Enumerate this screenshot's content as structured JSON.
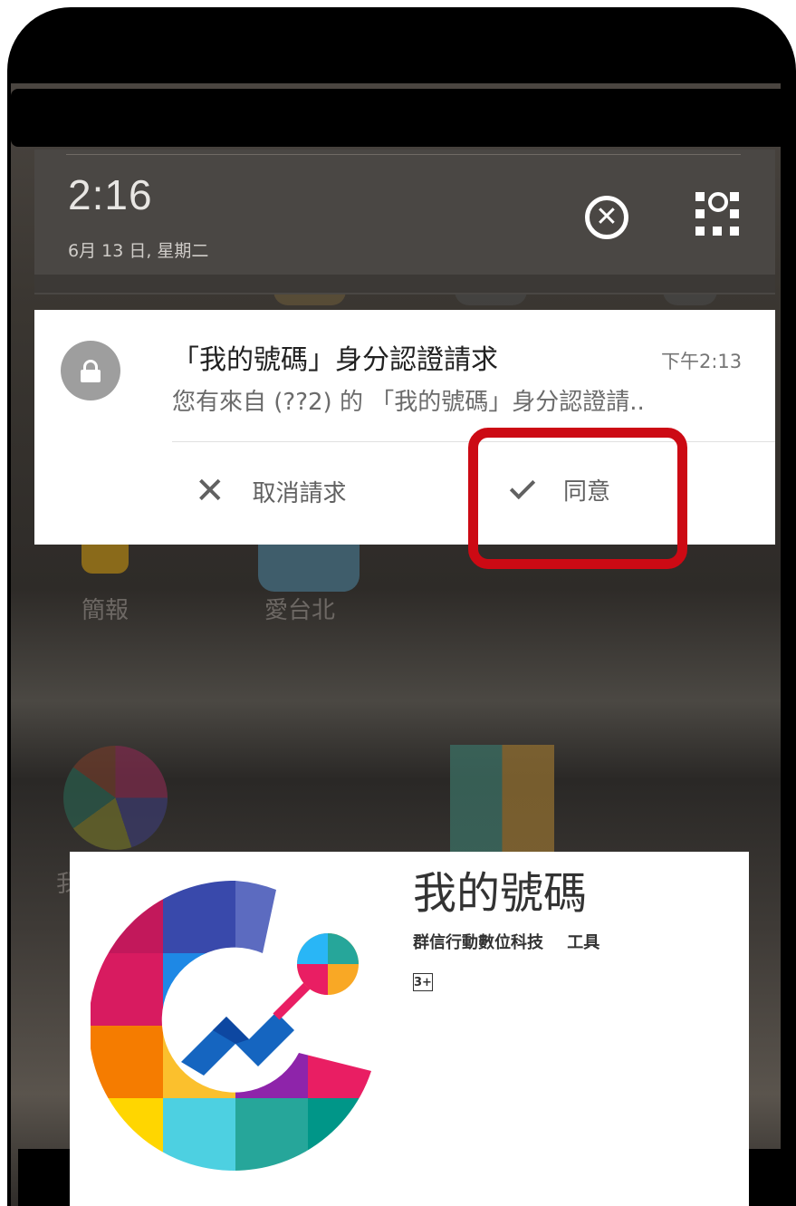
{
  "quick_panel": {
    "time": "2:16",
    "date": "6月 13 日, 星期二"
  },
  "notification": {
    "title": "「我的號碼」身分認證請求",
    "time": "下午2:13",
    "text": "您有來自 (??2) 的 「我的號碼」身分認證請..",
    "actions": {
      "cancel_label": "取消請求",
      "accept_label": "同意"
    }
  },
  "home": {
    "apps": [
      {
        "label": "簡報"
      },
      {
        "label": "愛台北"
      }
    ],
    "partial_label": "我"
  },
  "store": {
    "app_name": "我的號碼",
    "developer": "群信行動數位科技",
    "category": "工具",
    "rating": "3+"
  },
  "colors": {
    "highlight": "#cc0a14",
    "notification_bg": "#ffffff",
    "quick_panel_bg": "#4a4744"
  }
}
